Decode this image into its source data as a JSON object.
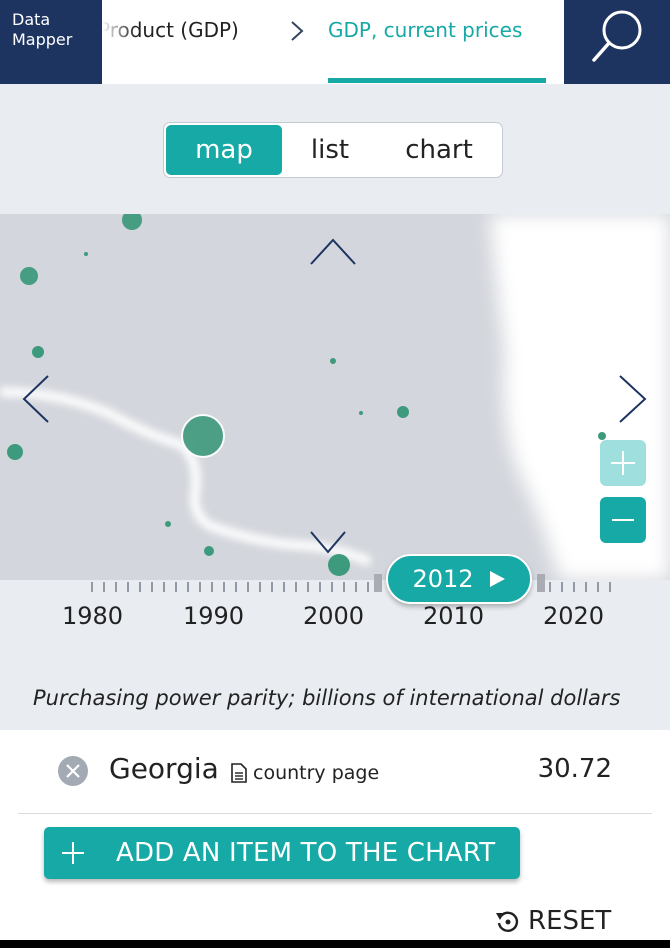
{
  "header": {
    "brand_line1": "Data",
    "brand_line2": "Mapper",
    "breadcrumb_parent": "Product (GDP)",
    "breadcrumb_current": "GDP, current prices",
    "search_icon": "search-icon"
  },
  "view_tabs": {
    "map": "map",
    "list": "list",
    "chart": "chart",
    "active": "map"
  },
  "colors": {
    "accent": "#16a9a6",
    "navy": "#1d3461",
    "bubble": "#3e9a7c",
    "zoom_in_disabled": "#9fe0df"
  },
  "timeline": {
    "selected_year": "2012",
    "tick_labels": [
      "1980",
      "1990",
      "2000",
      "2010",
      "2020"
    ]
  },
  "units_note": "Purchasing power parity; billions of international dollars",
  "selected_items": [
    {
      "name": "Georgia",
      "link_label": "country page",
      "value": "30.72"
    }
  ],
  "actions": {
    "add_item": "ADD AN ITEM TO THE CHART",
    "reset": "RESET"
  }
}
